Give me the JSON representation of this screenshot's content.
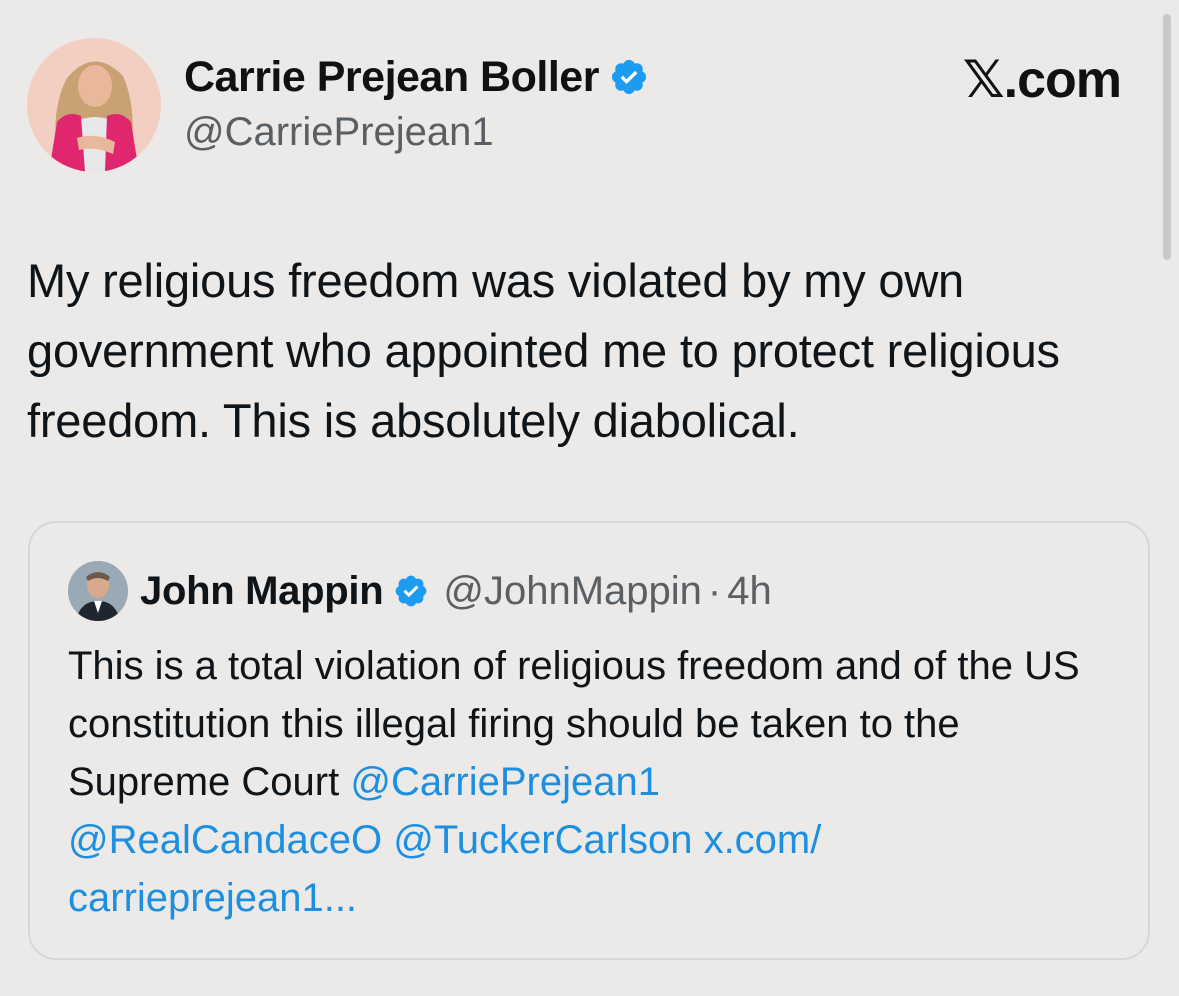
{
  "author": {
    "name": "Carrie Prejean Boller",
    "handle": "@CarriePrejean1"
  },
  "site_logo": "𝕏.com",
  "tweet": {
    "text": "My religious freedom was violated by my own government who appointed me to protect religious freedom. This is absolutely diabolical."
  },
  "quote": {
    "name": "John Mappin",
    "handle": "@JohnMappin",
    "separator": "·",
    "time": "4h",
    "text": "This is a total violation of religious freedom and of the US  constitution this illegal firing should be taken to the Supreme Court ",
    "mentions": [
      "@CarriePrejean1",
      "@RealCandaceO",
      "@TuckerCarlson"
    ],
    "link": "x.com/ carrieprejean1..."
  },
  "icons": {
    "verified": "verified-badge-icon",
    "verified_color": "#1d9bf0"
  },
  "colors": {
    "background": "#ebeae9",
    "link": "#1d8fe0",
    "muted": "#5a5f64"
  }
}
